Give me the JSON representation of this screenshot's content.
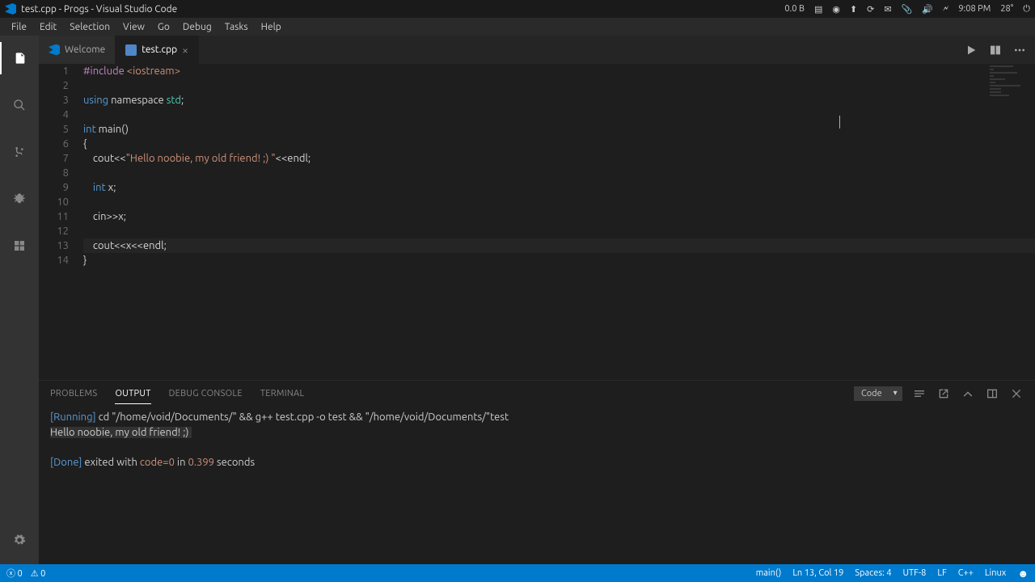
{
  "sysbar": {
    "title": "test.cpp - Progs - Visual Studio Code",
    "net": "0.0 B",
    "time": "9:08 PM",
    "temp": "28°"
  },
  "menu": [
    "File",
    "Edit",
    "Selection",
    "View",
    "Go",
    "Debug",
    "Tasks",
    "Help"
  ],
  "tabs": {
    "welcome": "Welcome",
    "file": "test.cpp"
  },
  "code": {
    "lines": [
      "1",
      "2",
      "3",
      "4",
      "5",
      "6",
      "7",
      "8",
      "9",
      "10",
      "11",
      "12",
      "13",
      "14"
    ],
    "l1_a": "#include",
    "l1_b": " <iostream>",
    "l3_a": "using",
    "l3_b": " namespace ",
    "l3_c": "std",
    "l3_d": ";",
    "l5_a": "int",
    "l5_b": " main()",
    "l6": "{",
    "l7_a": "    cout<<",
    "l7_b": "\"Hello noobie, my old friend! ;) \"",
    "l7_c": "<<endl;",
    "l9_a": "    ",
    "l9_b": "int",
    "l9_c": " x;",
    "l11": "    cin>>x;",
    "l13": "    cout<<x<<endl;",
    "l14": "}"
  },
  "panel": {
    "tabs": {
      "problems": "PROBLEMS",
      "output": "OUTPUT",
      "debug": "DEBUG CONSOLE",
      "terminal": "TERMINAL"
    },
    "select": "Code",
    "out": {
      "running_tag": "[Running]",
      "running_cmd": " cd \"/home/void/Documents/\" && g++ test.cpp -o test && \"/home/void/Documents/\"test",
      "hello": "Hello noobie, my old friend! ;) ",
      "done_tag": "[Done]",
      "done_a": " exited with ",
      "done_code": "code=0",
      "done_b": " in ",
      "done_time": "0.399",
      "done_c": " seconds"
    }
  },
  "status": {
    "errors": "0",
    "warnings": "0",
    "scope": "main()",
    "pos": "Ln 13, Col 19",
    "spaces": "Spaces: 4",
    "encoding": "UTF-8",
    "eol": "LF",
    "lang": "C++",
    "os": "Linux"
  }
}
